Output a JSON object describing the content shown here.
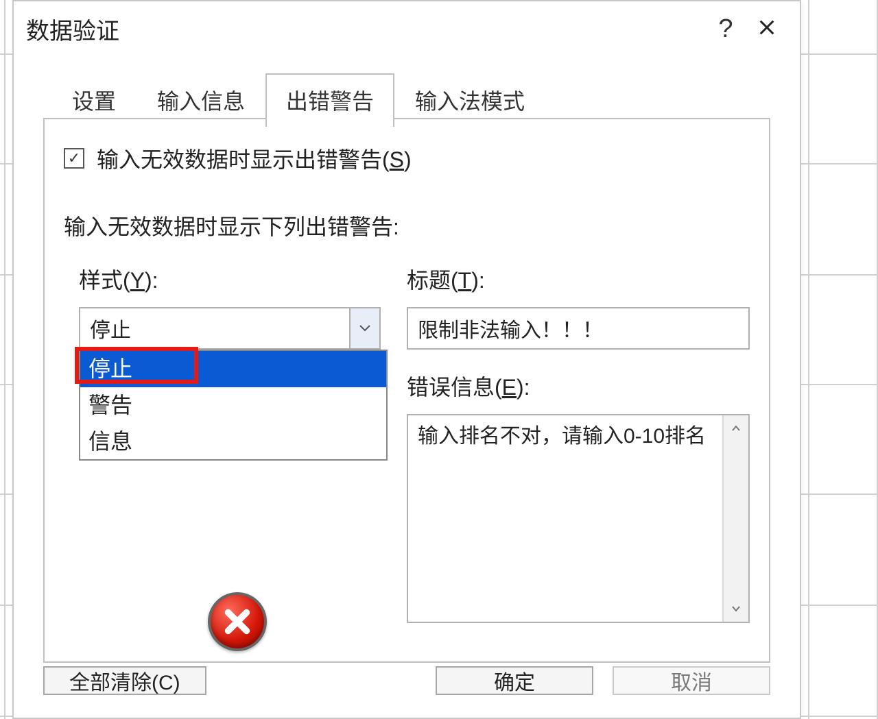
{
  "dialog": {
    "title": "数据验证",
    "help_tooltip": "?",
    "tabs": [
      "设置",
      "输入信息",
      "出错警告",
      "输入法模式"
    ],
    "active_tab_index": 2
  },
  "error_alert": {
    "checkbox_checked": true,
    "checkbox_label_prefix": "输入无效数据时显示出错警告(",
    "checkbox_label_key": "S",
    "checkbox_label_suffix": ")",
    "section_text": "输入无效数据时显示下列出错警告:",
    "style_label_prefix": "样式(",
    "style_label_key": "Y",
    "style_label_suffix": "):",
    "style_selected": "停止",
    "style_options": [
      "停止",
      "警告",
      "信息"
    ],
    "style_highlight_index": 0,
    "title_label_prefix": "标题(",
    "title_label_key": "T",
    "title_label_suffix": "):",
    "title_value": "限制非法输入！！！",
    "message_label_prefix": "错误信息(",
    "message_label_key": "E",
    "message_label_suffix": "):",
    "message_value": "输入排名不对，请输入0-10排名"
  },
  "buttons": {
    "clear_all": "全部清除(C)",
    "ok": "确定",
    "cancel": "取消"
  }
}
